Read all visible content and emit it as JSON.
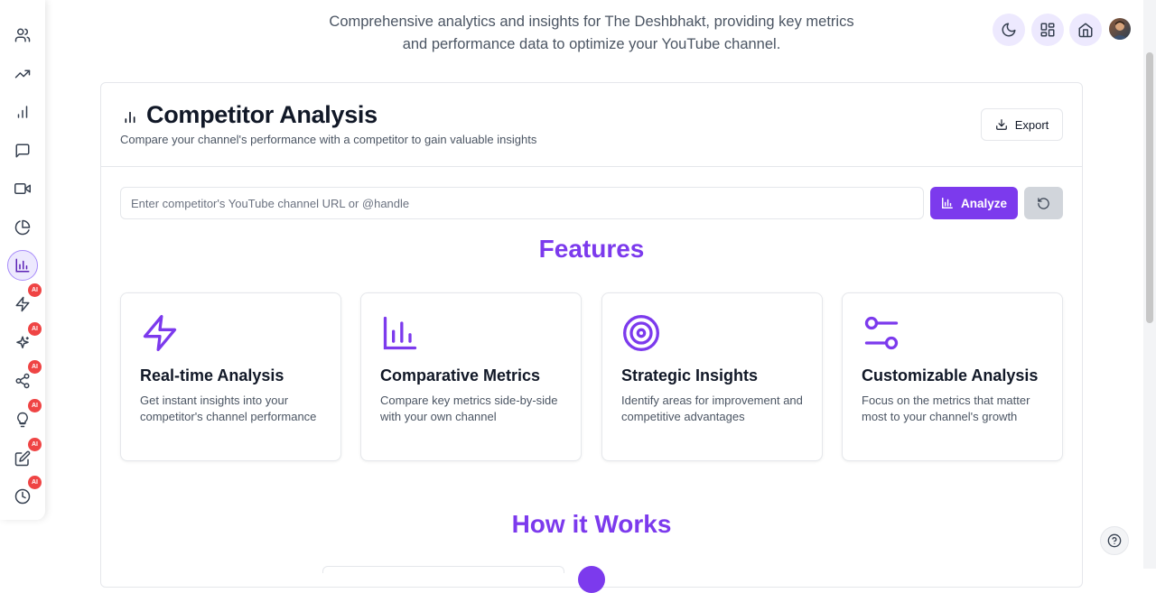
{
  "header": {
    "subtitle": "Comprehensive analytics and insights for The Deshbhakt, providing key metrics and performance data to optimize your YouTube channel."
  },
  "sidebar": {
    "items": [
      {
        "icon": "users-icon"
      },
      {
        "icon": "trending-up-icon"
      },
      {
        "icon": "bar-chart-icon"
      },
      {
        "icon": "message-icon"
      },
      {
        "icon": "video-icon"
      },
      {
        "icon": "pie-chart-icon"
      },
      {
        "icon": "chart-bars-icon",
        "active": true
      },
      {
        "icon": "zap-icon",
        "badge": "AI"
      },
      {
        "icon": "sparkles-icon",
        "badge": "AI"
      },
      {
        "icon": "share-icon",
        "badge": "AI"
      },
      {
        "icon": "lightbulb-icon",
        "badge": "AI"
      },
      {
        "icon": "edit-icon",
        "badge": "AI"
      },
      {
        "icon": "clock-icon",
        "badge": "AI"
      }
    ]
  },
  "top_buttons": [
    "moon-icon",
    "grid-icon",
    "home-icon"
  ],
  "page": {
    "title": "Competitor Analysis",
    "description": "Compare your channel's performance with a competitor to gain valuable insights",
    "export_label": "Export",
    "search_placeholder": "Enter competitor's YouTube channel URL or @handle",
    "analyze_label": "Analyze",
    "features_heading": "Features",
    "how_heading": "How it Works"
  },
  "features": [
    {
      "title": "Real-time Analysis",
      "text": "Get instant insights into your competitor's channel performance",
      "icon": "zap-icon"
    },
    {
      "title": "Comparative Metrics",
      "text": "Compare key metrics side-by-side with your own channel",
      "icon": "bar-chart-icon"
    },
    {
      "title": "Strategic Insights",
      "text": "Identify areas for improvement and competitive advantages",
      "icon": "target-icon"
    },
    {
      "title": "Customizable Analysis",
      "text": "Focus on the metrics that matter most to your channel's growth",
      "icon": "sliders-icon"
    }
  ],
  "colors": {
    "accent": "#7c3aed",
    "badge": "#ef4444",
    "active_bg": "#ede9fe"
  }
}
